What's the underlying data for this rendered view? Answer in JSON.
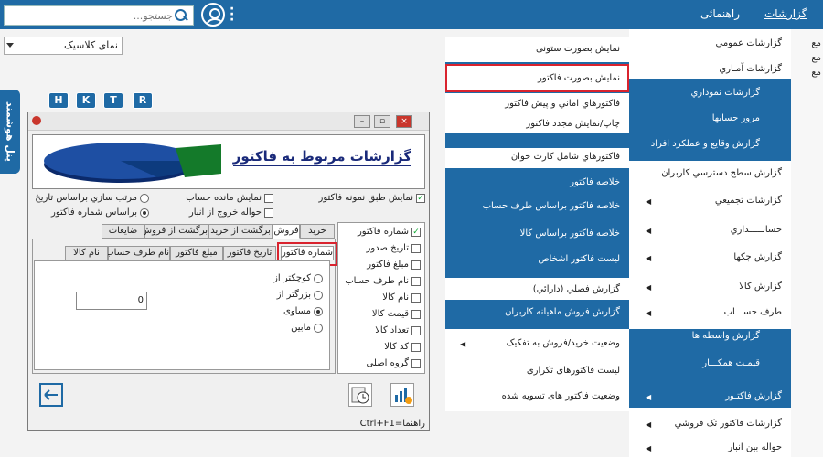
{
  "topbar": {
    "search_placeholder": "جستجو...",
    "menu_reports": "گزارشات",
    "menu_help": "راهنمائی"
  },
  "combo": {
    "selected": "نمای کلاسیک"
  },
  "sidetab": {
    "label": "پنل هوشمند"
  },
  "window": {
    "hk_buttons": [
      "H",
      "K",
      "T",
      "R"
    ],
    "banner_title": "گزارشات مربوط به فاکتور",
    "options": {
      "print_by_sample": "نمایش طبق نمونه فاکتور",
      "show_balance": "نمایش مانده حساب",
      "warehouse_exit": "حواله خروج از انبار",
      "sort_by_date": "مرتب سازي براساس تاريخ",
      "by_invoice_number": "براساس شماره فاکتور"
    },
    "tabs": [
      "خرید",
      "فروش",
      "برگشت از خرید",
      "برگشت از فروش",
      "ضایعات"
    ],
    "subtabs": [
      "شماره فاکتور",
      "تاریخ فاکتور",
      "مبلغ فاکتور",
      "نام طرف حساب",
      "نام کالا"
    ],
    "fields": [
      "شماره فاکتور",
      "تاریخ صدور",
      "مبلغ فاکتور",
      "نام طرف حساب",
      "نام کالا",
      "قیمت کالا",
      "تعداد کالا",
      "کد کالا",
      "گروه اصلی"
    ],
    "compare": [
      "کوچکتر از",
      "بزرگتر از",
      "مساوی",
      "مابین"
    ],
    "input_value": "0",
    "status": "راهنما=Ctrl+F1"
  },
  "menu1": [
    "نمایش بصورت ستونی",
    "نمایش بصورت فاکتور",
    "فاکتورهاي اماني و پيش فاکتور",
    "چاپ/نمایش مجدد فاکتور",
    "فاکتورهاي شامل کارت خوان",
    "خلاصه فاکتور",
    "خلاصه فاکتور براساس طرف حساب",
    "خلاصه فاکتور براساس کالا",
    "ليست فاکتور اشخاص",
    "گزارش فصلي (دارائي)",
    "گزارش فروش ماهيانه کاربران",
    "وضعیت خرید/فروش به تفکیک",
    "لیست فاکتورهای تکراری",
    "وضعیت فاکتور های تسویه شده"
  ],
  "menu2": [
    "گزارشات عمومي",
    "گزارشات آمـاري",
    "گزارشات نموداري",
    "مرور حسابها",
    "گزارش وقايع و عملکرد افراد",
    "گزارش سطح دسترسي کاربران",
    "گزارشات تجميعي",
    "حسابـــــداري",
    "گزارش چکها",
    "گزارش کالا",
    "طرف حســـاب",
    "گزارش واسطه ها",
    "قیمـت همکـــار",
    "گزارش فاکتـور",
    "گزارشات فاکتور تک فروشي",
    "حواله بين انبار"
  ],
  "rightpane": [
    "مع",
    "مع",
    "مع"
  ]
}
